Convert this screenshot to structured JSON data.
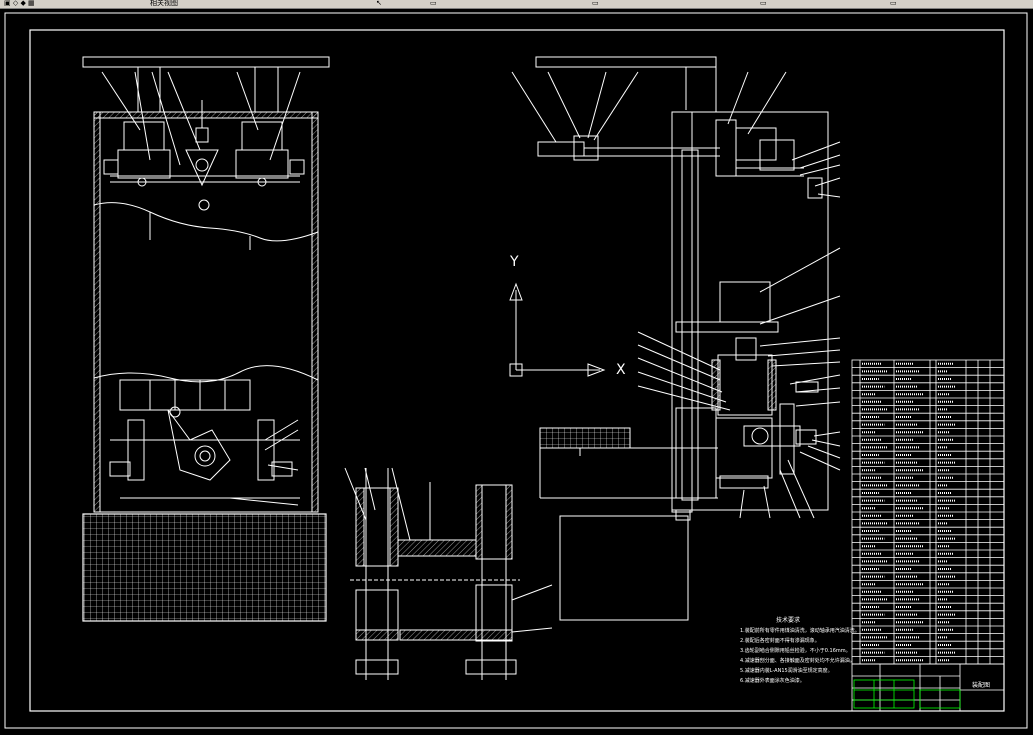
{
  "window": {
    "toolbar_text_1": "相关视图",
    "toolbar_icon_a": "arrow-icon",
    "toolbar_icon_b": "layer-icon"
  },
  "drawing": {
    "axis_y_label": "Y",
    "axis_x_label": "X",
    "notes_title": "技术要求",
    "notes": [
      "1.装配前所有零件用煤油清洗，滚动轴承用汽油清洗。",
      "2.装配后各密封面不得有渗漏现象。",
      "3.齿轮副啮合侧隙用铅丝检验，不小于0.16mm。",
      "4.减速器剖分面、各接触面及密封处均不允许漏油。",
      "5.减速器内装L-AN15润滑油至规定高度。",
      "6.减速器外表面涂灰色油漆。"
    ],
    "title_block_name": "装配图"
  },
  "colors": {
    "background": "#000000",
    "lines": "#ffffff",
    "dim": "#c8c8c8",
    "table_green": "#00ff00",
    "toolbar": "#d4d0c8"
  }
}
